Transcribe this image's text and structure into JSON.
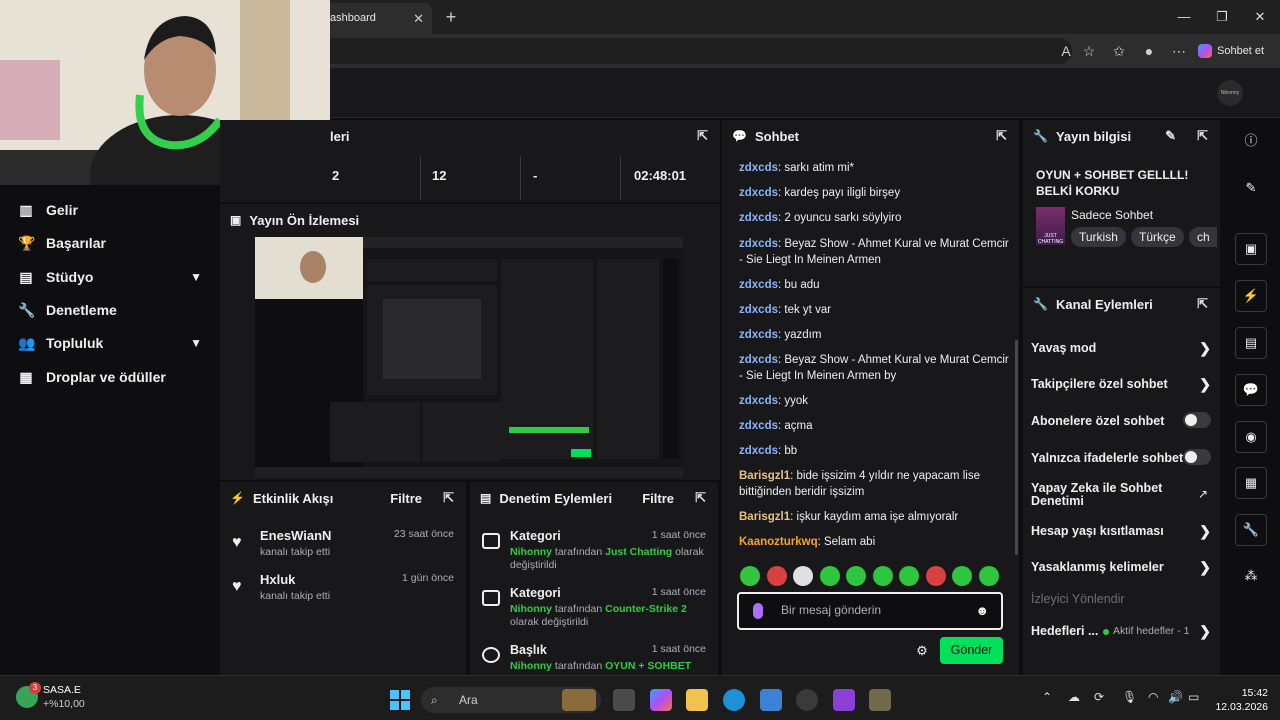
{
  "browser": {
    "tab_title": "ashboard",
    "copilot_label": "Sohbet et"
  },
  "nav": {
    "items": [
      {
        "label": "Gelir",
        "icon": "chart-icon"
      },
      {
        "label": "Başarılar",
        "icon": "trophy-icon"
      },
      {
        "label": "Stüdyo",
        "icon": "studio-icon",
        "expandable": true
      },
      {
        "label": "Denetleme",
        "icon": "wrench-icon"
      },
      {
        "label": "Topluluk",
        "icon": "people-icon",
        "expandable": true
      },
      {
        "label": "Droplar ve ödüller",
        "icon": "gift-icon"
      }
    ]
  },
  "stats": {
    "title": "leri",
    "values": [
      "2",
      "12",
      "-",
      "02:48:01"
    ]
  },
  "preview": {
    "title": "Yayın Ön İzlemesi"
  },
  "activity": {
    "title": "Etkinlik Akışı",
    "filter_label": "Filtre",
    "items": [
      {
        "name": "EnesWianN",
        "desc": "kanalı takip etti",
        "time": "23 saat önce"
      },
      {
        "name": "Hxluk",
        "desc": "kanalı takip etti",
        "time": "1 gün önce"
      }
    ]
  },
  "modactions": {
    "title": "Denetim Eylemleri",
    "filter_label": "Filtre",
    "items": [
      {
        "title": "Kategori",
        "time": "1 saat önce",
        "actor": "Nihonny",
        "mid": " tarafından ",
        "target": "Just Chatting",
        "tail": " olarak değiştirildi"
      },
      {
        "title": "Kategori",
        "time": "1 saat önce",
        "actor": "Nihonny",
        "mid": " tarafından ",
        "target": "Counter-Strike 2",
        "tail": " olarak değiştirildi"
      },
      {
        "title": "Başlık",
        "time": "1 saat önce",
        "actor": "Nihonny",
        "mid": " tarafından ",
        "target": "OYUN + SOHBET",
        "tail": ""
      }
    ]
  },
  "chat": {
    "title": "Sohbet",
    "messages": [
      {
        "user": "zdxcds",
        "color": "#8ab4f8",
        "text": "sarkı atim mi*"
      },
      {
        "user": "zdxcds",
        "color": "#8ab4f8",
        "text": "kardeş payı iligli birşey"
      },
      {
        "user": "zdxcds",
        "color": "#8ab4f8",
        "text": "2 oyuncu sarkı söylyiro"
      },
      {
        "user": "zdxcds",
        "color": "#8ab4f8",
        "text": "Beyaz Show - Ahmet Kural ve Murat Cemcir - Sie Liegt In Meinen Armen"
      },
      {
        "user": "zdxcds",
        "color": "#8ab4f8",
        "text": "bu adu"
      },
      {
        "user": "zdxcds",
        "color": "#8ab4f8",
        "text": "tek yt var"
      },
      {
        "user": "zdxcds",
        "color": "#8ab4f8",
        "text": "yazdım"
      },
      {
        "user": "zdxcds",
        "color": "#8ab4f8",
        "text": "Beyaz Show - Ahmet Kural ve Murat Cemcir - Sie Liegt In Meinen Armen by"
      },
      {
        "user": "zdxcds",
        "color": "#8ab4f8",
        "text": "yyok"
      },
      {
        "user": "zdxcds",
        "color": "#8ab4f8",
        "text": "açma"
      },
      {
        "user": "zdxcds",
        "color": "#8ab4f8",
        "text": "bb"
      },
      {
        "user": "Barisgzl1",
        "color": "#e8c37e",
        "text": "bide işsizim 4 yıldır ne yapacam lise bittiğinden beridir işsizim"
      },
      {
        "user": "Barisgzl1",
        "color": "#e8c37e",
        "text": "işkur kaydım ama işe almıyoralr"
      },
      {
        "user": "Kaanozturkwq",
        "color": "#f5a623",
        "text": "Selam abi"
      }
    ],
    "input_placeholder": "Bir mesaj gönderin",
    "send_label": "Gönder"
  },
  "streaminfo": {
    "title": "Yayın bilgisi",
    "stream_title": "OYUN + SOHBET GELLLL! BELKİ KORKU",
    "category": "Sadece Sohbet",
    "category_tile_text": "JUST CHATTING",
    "tags": [
      "Turkish",
      "Türkçe",
      "ch"
    ]
  },
  "channelactions": {
    "title": "Kanal Eylemleri",
    "items": [
      {
        "label": "Yavaş mod",
        "control": "arrow"
      },
      {
        "label": "Takipçilere özel sohbet",
        "control": "arrow"
      },
      {
        "label": "Abonelere özel sohbet",
        "control": "toggle"
      },
      {
        "label": "Yalnızca ifadelerle sohbet",
        "control": "toggle"
      },
      {
        "label": "Yapay Zeka ile Sohbet Denetimi",
        "control": "external"
      },
      {
        "label": "Hesap yaşı kısıtlaması",
        "control": "arrow"
      },
      {
        "label": "Yasaklanmış kelimeler",
        "control": "arrow"
      }
    ],
    "disabled_label": "İzleyici Yönlendir",
    "goals_label": "Hedefleri ...",
    "goals_status": "Aktif hedefler - 1"
  },
  "taskbar": {
    "weather_name": "SASA.E",
    "weather_value": "+%10,00",
    "weather_badge": "3",
    "search_label": "Ara",
    "time": "15:42",
    "date": "12.03.2026"
  },
  "brand": {
    "logo_text": "Nihonny"
  }
}
